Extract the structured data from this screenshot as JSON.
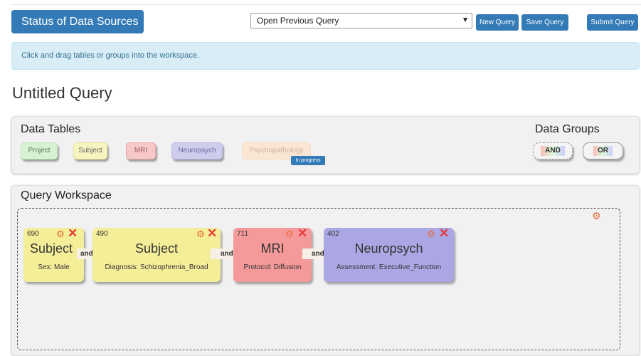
{
  "header": {
    "status_button": "Status of Data Sources",
    "query_select": "Open Previous Query",
    "new_query": "New Query",
    "save_query": "Save Query",
    "submit_query": "Submit Query"
  },
  "alert": "Click and drag tables or groups into the workspace.",
  "query_title": "Untitled Query",
  "data_tables": {
    "title": "Data Tables",
    "items": [
      {
        "label": "Project",
        "color": "#d7f2d2"
      },
      {
        "label": "Subject",
        "color": "#f8f4c0"
      },
      {
        "label": "MRI",
        "color": "#f6c8c8"
      },
      {
        "label": "Neuropsych",
        "color": "#cfcdee"
      },
      {
        "label": "Psychopathology",
        "color": "#fbe6d4"
      }
    ],
    "in_progress_badge": "In progress"
  },
  "data_groups": {
    "title": "Data Groups",
    "and_label": "AND",
    "or_label": "OR"
  },
  "workspace": {
    "title": "Query Workspace",
    "connector": "and",
    "cards": [
      {
        "count": "690",
        "name": "Subject",
        "desc": "Sex: Male",
        "color": "#f5ee99"
      },
      {
        "count": "490",
        "name": "Subject",
        "desc": "Diagnosis: Schizophrenia_Broad",
        "color": "#f5ee99"
      },
      {
        "count": "711",
        "name": "MRI",
        "desc": "Protocol: Diffusion",
        "color": "#f49a9a"
      },
      {
        "count": "402",
        "name": "Neuropsych",
        "desc": "Assessment: Executive_Function",
        "color": "#aaa7e4"
      }
    ]
  }
}
